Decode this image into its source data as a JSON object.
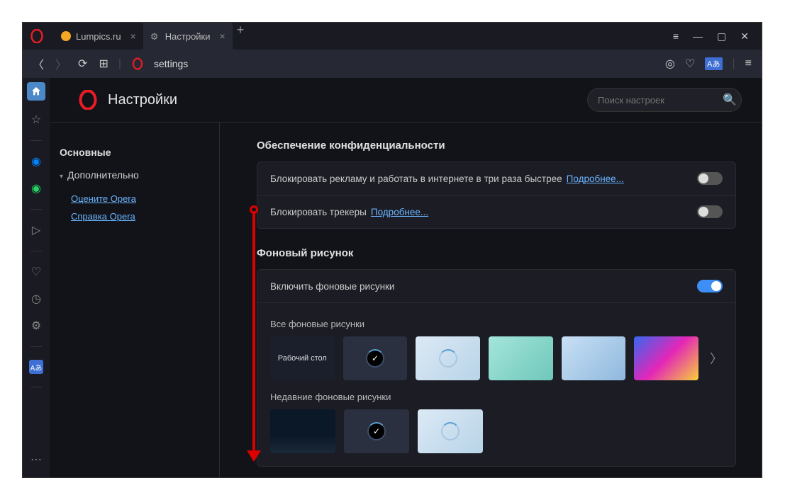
{
  "tabs": [
    {
      "label": "Lumpics.ru",
      "active": false
    },
    {
      "label": "Настройки",
      "active": true
    }
  ],
  "address": "settings",
  "page_title": "Настройки",
  "search_placeholder": "Поиск настроек",
  "nav": {
    "main": "Основные",
    "advanced": "Дополнительно",
    "rate": "Оцените Opera",
    "help": "Справка Opera"
  },
  "privacy": {
    "title": "Обеспечение конфиденциальности",
    "block_ads": "Блокировать рекламу и работать в интернете в три раза быстрее",
    "block_trackers": "Блокировать трекеры",
    "learn_more": "Подробнее..."
  },
  "wallpaper": {
    "title": "Фоновый рисунок",
    "enable": "Включить фоновые рисунки",
    "all": "Все фоновые рисунки",
    "recent": "Недавние фоновые рисунки",
    "desktop_label": "Рабочий стол"
  }
}
